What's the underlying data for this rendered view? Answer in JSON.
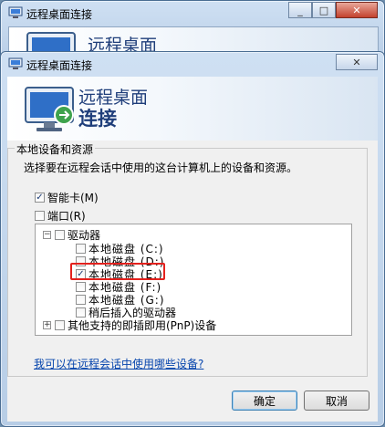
{
  "back_window": {
    "title": "远程桌面连接",
    "banner_line1": "远程桌面",
    "controls": [
      "_",
      "□",
      "✕"
    ]
  },
  "dialog": {
    "title": "远程桌面连接",
    "banner_line1": "远程桌面",
    "banner_line2": "连接",
    "controls": [
      "✕"
    ],
    "group_title": "本地设备和资源",
    "description": "选择要在远程会话中使用的这台计算机上的设备和资源。",
    "smart_card": {
      "label": "智能卡(M)",
      "checked": true
    },
    "ports": {
      "label": "端口(R)",
      "checked": false
    },
    "tree": {
      "drives": {
        "label": "驱动器",
        "expander": "⊟",
        "checked": false
      },
      "items": [
        {
          "label": "本地磁盘 (C:)",
          "checked": false
        },
        {
          "label": "本地磁盘 (D:)",
          "checked": false
        },
        {
          "label": "本地磁盘 (E:)",
          "checked": true
        },
        {
          "label": "本地磁盘 (F:)",
          "checked": false
        },
        {
          "label": "本地磁盘 (G:)",
          "checked": false
        },
        {
          "label": "稍后插入的驱动器",
          "checked": false
        }
      ],
      "pnp": {
        "label": "其他支持的即插即用(PnP)设备",
        "expander": "⊞",
        "checked": false
      }
    },
    "help_link": "我可以在远程会话中使用哪些设备?",
    "ok_label": "确定",
    "cancel_label": "取消",
    "highlight_color": "#e3211d"
  }
}
